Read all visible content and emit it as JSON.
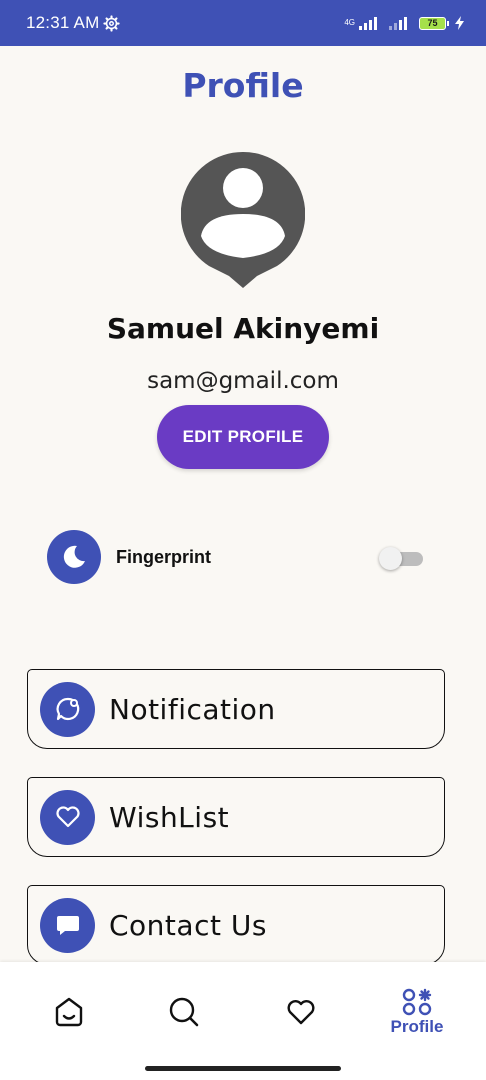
{
  "status_bar": {
    "time": "12:31 AM",
    "network": "4G",
    "battery": "75",
    "icons": [
      "settings-gear-icon",
      "signal-icon",
      "battery-icon",
      "charging-icon"
    ]
  },
  "header": {
    "title": "Profile"
  },
  "profile": {
    "name": "Samuel Akinyemi",
    "email": "sam@gmail.com",
    "edit_button": "EDIT PROFILE",
    "avatar_icon": "account-pin-icon"
  },
  "settings": {
    "fingerprint": {
      "label": "Fingerprint",
      "enabled": false,
      "icon": "moon-icon"
    }
  },
  "menu": [
    {
      "label": "Notification",
      "icon": "chat-bubble-icon"
    },
    {
      "label": "WishList",
      "icon": "heart-icon"
    },
    {
      "label": "Contact Us",
      "icon": "message-icon"
    }
  ],
  "bottom_nav": {
    "items": [
      {
        "icon": "home-icon",
        "label": ""
      },
      {
        "icon": "search-icon",
        "label": ""
      },
      {
        "icon": "heart-icon",
        "label": ""
      },
      {
        "icon": "category-icon",
        "label": "Profile",
        "active": true
      }
    ]
  },
  "colors": {
    "primary": "#3f51b5",
    "button": "#6a3bc4",
    "background": "#faf8f4",
    "avatar": "#555555"
  }
}
